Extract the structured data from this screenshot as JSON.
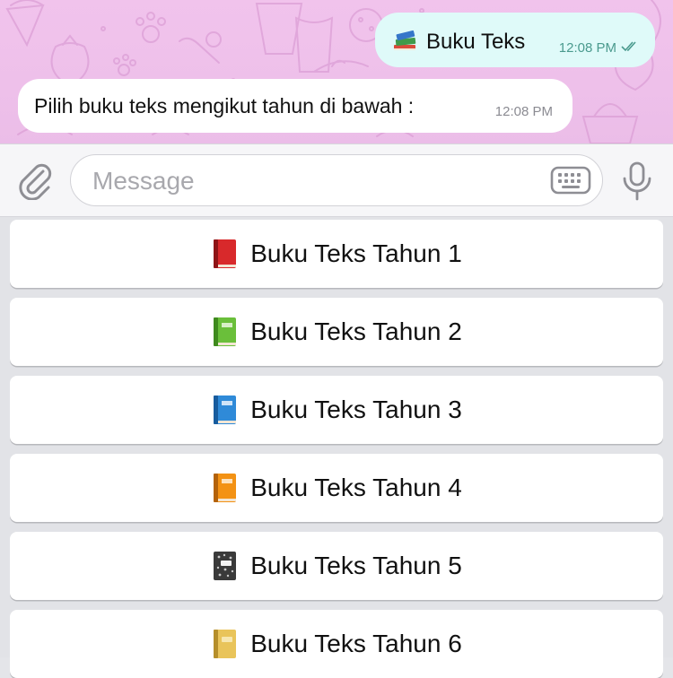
{
  "chat": {
    "outgoing": {
      "emoji": "books-emoji",
      "text": "Buku Teks",
      "time": "12:08 PM",
      "status": "read-double-check"
    },
    "incoming": {
      "text": "Pilih buku teks mengikut tahun di bawah :",
      "time": "12:08 PM"
    }
  },
  "composer": {
    "placeholder": "Message",
    "attach_icon": "paperclip-icon",
    "keyboard_icon": "keyboard-icon",
    "mic_icon": "microphone-icon"
  },
  "keyboard": {
    "buttons": [
      {
        "label": "Buku Teks Tahun 1",
        "icon": "red-book-icon",
        "color": "#d8292b"
      },
      {
        "label": "Buku Teks Tahun 2",
        "icon": "green-book-icon",
        "color": "#6abf3a"
      },
      {
        "label": "Buku Teks Tahun 3",
        "icon": "blue-book-icon",
        "color": "#2f8ad8"
      },
      {
        "label": "Buku Teks Tahun 4",
        "icon": "orange-book-icon",
        "color": "#f39214"
      },
      {
        "label": "Buku Teks Tahun 5",
        "icon": "notebook-icon",
        "color": "#3a3a3a"
      },
      {
        "label": "Buku Teks Tahun 6",
        "icon": "ledger-icon",
        "color": "#e9c45a"
      }
    ]
  },
  "colors": {
    "chat_background": "#efc1eb",
    "outgoing_bubble": "#dffaf9",
    "incoming_bubble": "#ffffff",
    "composer_background": "#f6f6f8",
    "keyboard_background": "#e2e3e7"
  }
}
